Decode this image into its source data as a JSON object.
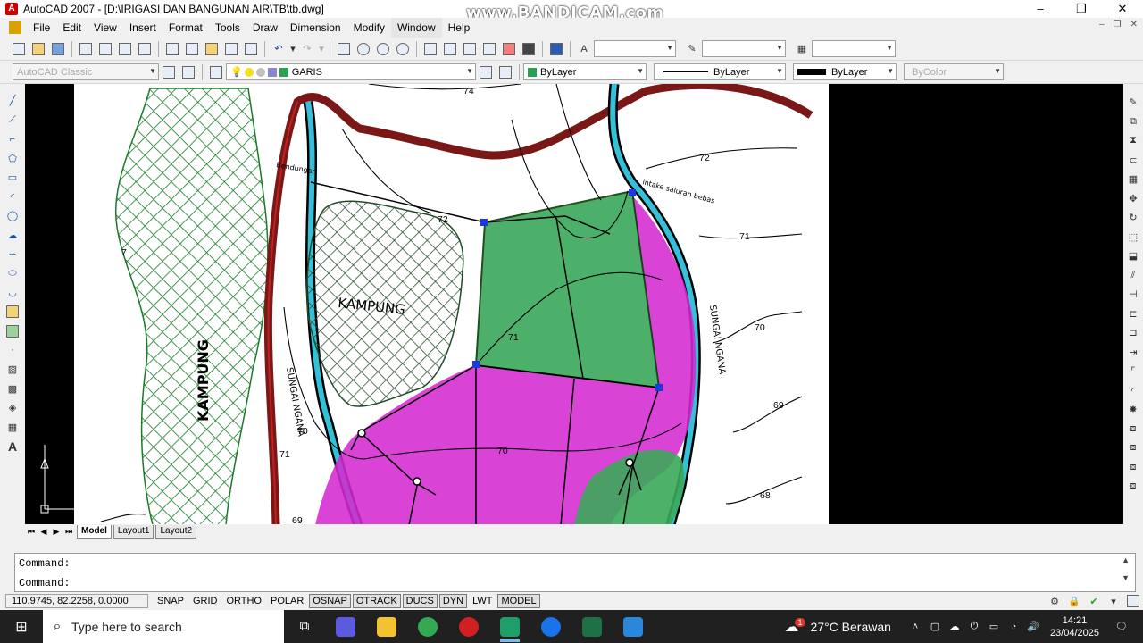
{
  "window": {
    "title": "AutoCAD 2007 - [D:\\IRIGASI DAN BANGUNAN AIR\\TB\\tb.dwg]",
    "watermark": "www.BANDICAM.com",
    "controls": [
      "–",
      "❐",
      "✕"
    ]
  },
  "menu": {
    "items": [
      "File",
      "Edit",
      "View",
      "Insert",
      "Format",
      "Tools",
      "Draw",
      "Dimension",
      "Modify",
      "Window",
      "Help"
    ],
    "doc_controls": [
      "–",
      "❐",
      "✕"
    ]
  },
  "toolbar2": {
    "workspace": "AutoCAD Classic",
    "layer": "GARIS",
    "color": "ByLayer",
    "linetype": "ByLayer",
    "lineweight": "ByLayer",
    "plotstyle": "ByColor"
  },
  "drawing": {
    "labels": {
      "contour_74": "74",
      "contour_72a": "72",
      "contour_72b": "72",
      "contour_71a": "71",
      "contour_71b": "71",
      "contour_71c": "71",
      "contour_70a": "70",
      "contour_70b": "70",
      "contour_70c": "70",
      "contour_69a": "69",
      "contour_69b": "69",
      "contour_68": "68",
      "contour_7x": "7",
      "kampung_left": "KAMPUNG",
      "kampung_center": "KAMPUNG",
      "sungai_left": "SUNGAI NGANA",
      "sungai_right": "SUNGAI NGANA",
      "bendungan": "Bendungan",
      "intake": "intake saluran bebas"
    },
    "colors": {
      "green_area": "#3aa85a",
      "magenta_area": "#d42ad0",
      "river": "#33c0d8",
      "road": "#8b1a1a",
      "hatch": "#1a7a2a"
    }
  },
  "layout_tabs": [
    "Model",
    "Layout1",
    "Layout2"
  ],
  "command": {
    "line1": "Command:",
    "line2": "Command:"
  },
  "status": {
    "coords": "110.9745, 82.2258, 0.0000",
    "buttons": [
      {
        "label": "SNAP",
        "on": false
      },
      {
        "label": "GRID",
        "on": false
      },
      {
        "label": "ORTHO",
        "on": false
      },
      {
        "label": "POLAR",
        "on": false
      },
      {
        "label": "OSNAP",
        "on": true
      },
      {
        "label": "OTRACK",
        "on": true
      },
      {
        "label": "DUCS",
        "on": true
      },
      {
        "label": "DYN",
        "on": true
      },
      {
        "label": "LWT",
        "on": false
      },
      {
        "label": "MODEL",
        "on": true
      }
    ]
  },
  "taskbar": {
    "search_placeholder": "Type here to search",
    "weather": "27°C  Berawan",
    "weather_badge": "1",
    "time": "14:21",
    "date": "23/04/2025",
    "app_colors": [
      "#4c8fd8",
      "#5b5be0",
      "#f2c230",
      "#34a853",
      "#d02020",
      "#1f9e6a",
      "#1a73e8",
      "#1e7145",
      "#2b88d8"
    ]
  }
}
